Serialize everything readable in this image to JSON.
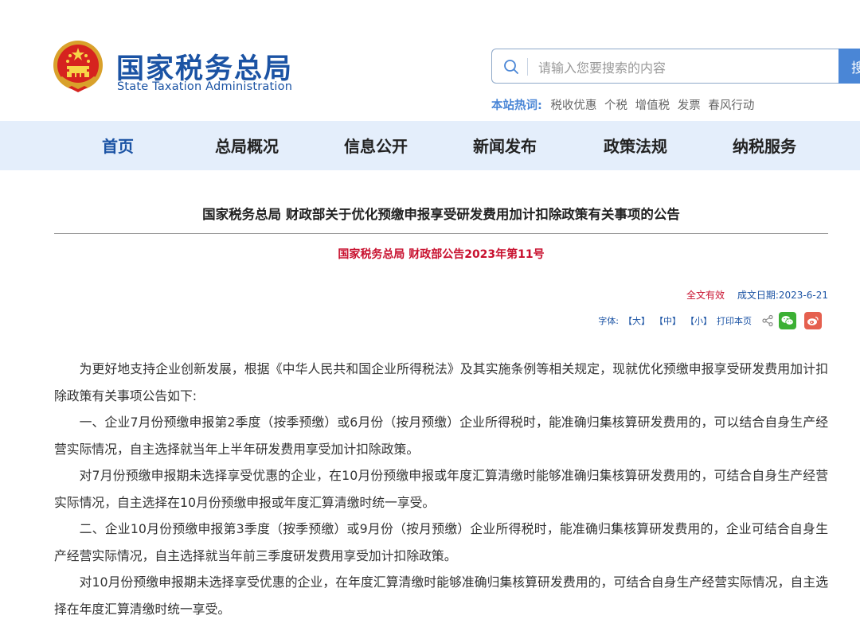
{
  "header": {
    "site_name_cn": "国家税务总局",
    "site_name_en": "State Taxation Administration",
    "emblem_icon": "national-emblem-icon"
  },
  "search": {
    "placeholder": "请输入您要搜索的内容",
    "button_label": "搜",
    "hot_label": "本站热词:",
    "hot_terms": [
      "税收优惠",
      "个税",
      "增值税",
      "发票",
      "春风行动"
    ]
  },
  "nav": {
    "items": [
      {
        "label": "首页",
        "active": true
      },
      {
        "label": "总局概况"
      },
      {
        "label": "信息公开"
      },
      {
        "label": "新闻发布"
      },
      {
        "label": "政策法规"
      },
      {
        "label": "纳税服务"
      }
    ]
  },
  "article": {
    "title": "国家税务总局 财政部关于优化预缴申报享受研发费用加计扣除政策有关事项的公告",
    "doc_number": "国家税务总局  财政部公告2023年第11号",
    "validity": "全文有效",
    "date_label": "成文日期:",
    "date_value": "2023-6-21",
    "font_label": "字体:",
    "font_large": "【大】",
    "font_medium": "【中】",
    "font_small": "【小】",
    "print_label": "打印本页",
    "paragraphs": [
      "为更好地支持企业创新发展，根据《中华人民共和国企业所得税法》及其实施条例等相关规定，现就优化预缴申报享受研发费用加计扣除政策有关事项公告如下:",
      "一、企业7月份预缴申报第2季度（按季预缴）或6月份（按月预缴）企业所得税时，能准确归集核算研发费用的，可以结合自身生产经营实际情况，自主选择就当年上半年研发费用享受加计扣除政策。",
      "对7月份预缴申报期未选择享受优惠的企业，在10月份预缴申报或年度汇算清缴时能够准确归集核算研发费用的，可结合自身生产经营实际情况，自主选择在10月份预缴申报或年度汇算清缴时统一享受。",
      "二、企业10月份预缴申报第3季度（按季预缴）或9月份（按月预缴）企业所得税时，能准确归集核算研发费用的，企业可结合自身生产经营实际情况，自主选择就当年前三季度研发费用享受加计扣除政策。",
      "对10月份预缴申报期未选择享受优惠的企业，在年度汇算清缴时能够准确归集核算研发费用的，可结合自身生产经营实际情况，自主选择在年度汇算清缴时统一享受。"
    ]
  }
}
